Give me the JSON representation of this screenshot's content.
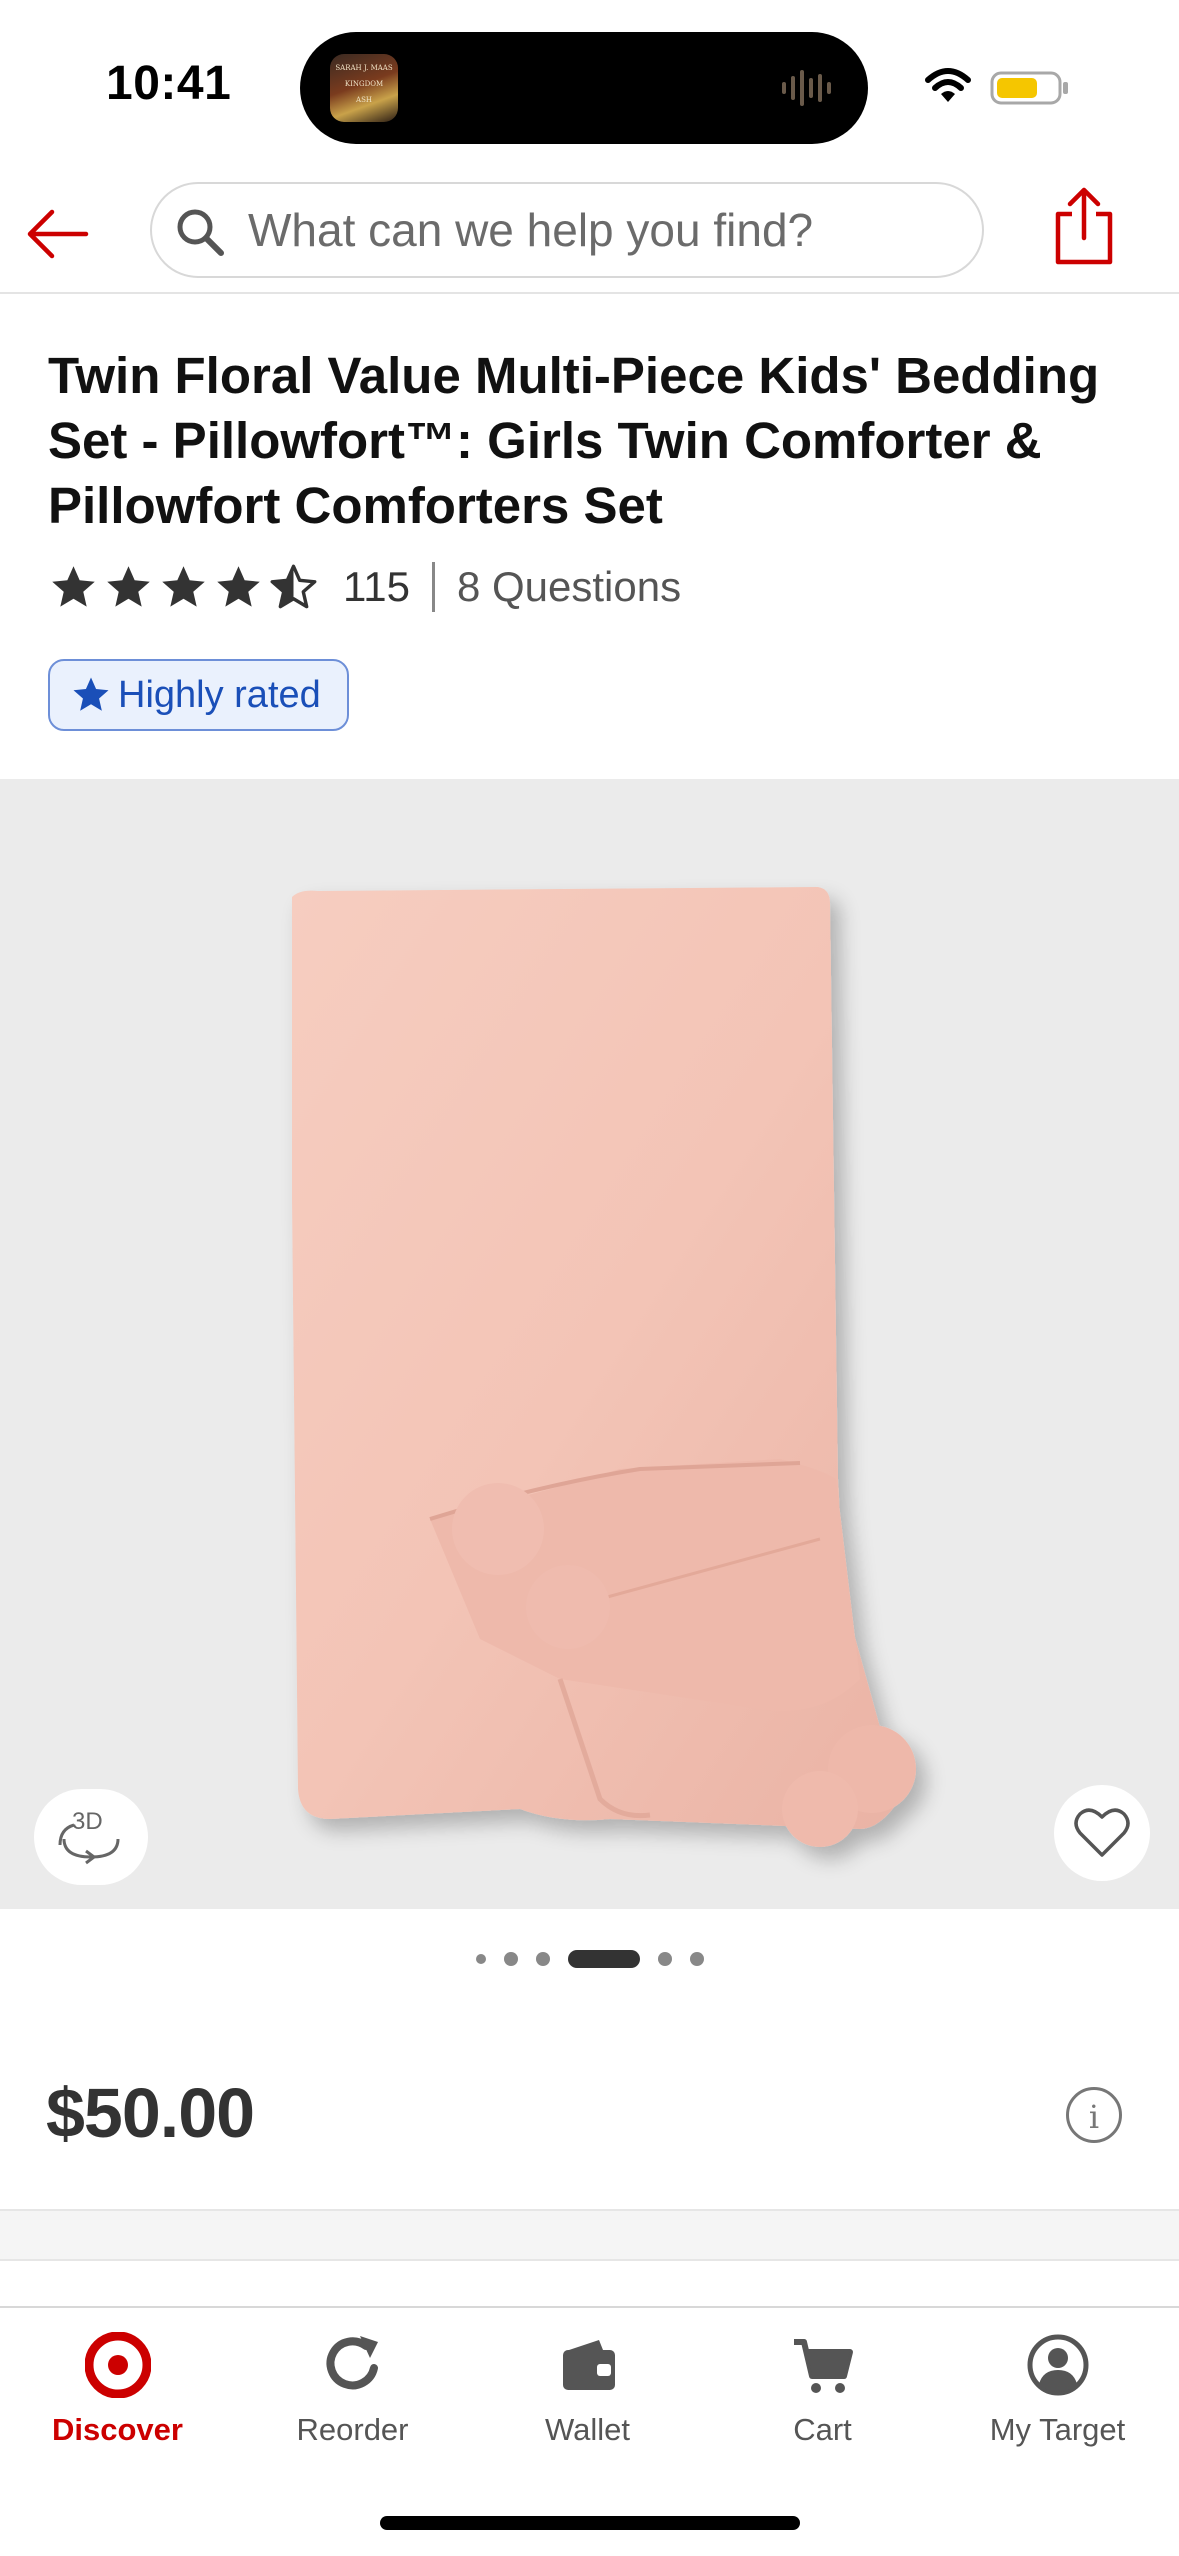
{
  "status_bar": {
    "time": "10:41",
    "album_art_text": [
      "SARAH J. MAAS",
      "KINGDOM",
      "ASH"
    ]
  },
  "search": {
    "placeholder": "What can we help you find?"
  },
  "product": {
    "title": "Twin Floral Value Multi-Piece Kids' Bedding Set - Pillowfort™: Girls Twin Comforter & Pillowfort Comforters Set",
    "rating": 4.5,
    "rating_count": "115",
    "questions": "8 Questions",
    "badge": "Highly rated",
    "price": "$50.00",
    "btn_3d_label": "3D"
  },
  "carousel": {
    "total": 6,
    "active_index": 3
  },
  "tabs": [
    {
      "label": "Discover",
      "icon": "target-bullseye-icon",
      "active": true
    },
    {
      "label": "Reorder",
      "icon": "reorder-icon",
      "active": false
    },
    {
      "label": "Wallet",
      "icon": "wallet-icon",
      "active": false
    },
    {
      "label": "Cart",
      "icon": "cart-icon",
      "active": false
    },
    {
      "label": "My Target",
      "icon": "profile-icon",
      "active": false
    }
  ],
  "colors": {
    "brand_red": "#cc0000",
    "badge_blue": "#1a4fb8",
    "image_bg": "#ebebeb",
    "blanket_pink": "#f2c3b6"
  }
}
